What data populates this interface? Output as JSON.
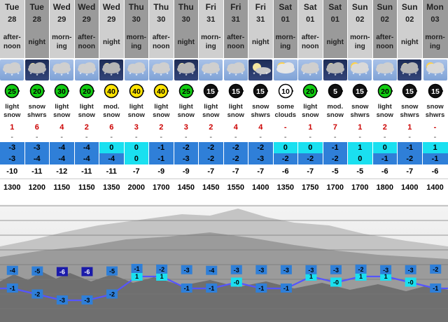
{
  "columns": [
    {
      "day": "Tue",
      "date": "28",
      "time": "after-noon",
      "period": "day",
      "icon": "snow-cloud-icon",
      "wind": "25",
      "wind_style": "green",
      "summary": "light snow",
      "snow": "1",
      "rain": "-",
      "max": "-3",
      "min": "-3",
      "max_band": "blue",
      "min_band": "blue",
      "chill": "-10",
      "freezing": "1300"
    },
    {
      "day": "Tue",
      "date": "28",
      "time": "night",
      "period": "night",
      "icon": "night-snow-icon",
      "wind": "20",
      "wind_style": "green",
      "summary": "snow shwrs",
      "snow": "6",
      "rain": "-",
      "max": "-3",
      "min": "-4",
      "max_band": "blue",
      "min_band": "blue",
      "chill": "-11",
      "freezing": "1200"
    },
    {
      "day": "Wed",
      "date": "29",
      "time": "morn-ing",
      "period": "day",
      "icon": "snow-cloud-icon",
      "wind": "30",
      "wind_style": "green",
      "summary": "light snow",
      "snow": "4",
      "rain": "-",
      "max": "-4",
      "min": "-4",
      "max_band": "blue",
      "min_band": "blue",
      "chill": "-12",
      "freezing": "1150"
    },
    {
      "day": "Wed",
      "date": "29",
      "time": "after-noon",
      "period": "day",
      "icon": "snow-cloud-icon",
      "wind": "20",
      "wind_style": "green",
      "summary": "light snow",
      "snow": "2",
      "rain": "-",
      "max": "-4",
      "min": "-4",
      "max_band": "blue",
      "min_band": "blue",
      "chill": "-11",
      "freezing": "1150"
    },
    {
      "day": "Wed",
      "date": "29",
      "time": "night",
      "period": "night",
      "icon": "night-snow-icon",
      "wind": "40",
      "wind_style": "yellow",
      "summary": "mod. snow",
      "snow": "6",
      "rain": "-",
      "max": "0",
      "min": "-4",
      "max_band": "cyan",
      "min_band": "blue",
      "chill": "-11",
      "freezing": "1350"
    },
    {
      "day": "Thu",
      "date": "30",
      "time": "morn-ing",
      "period": "day",
      "icon": "snow-cloud-icon",
      "wind": "40",
      "wind_style": "yellow",
      "summary": "light snow",
      "snow": "3",
      "rain": "-",
      "max": "0",
      "min": "0",
      "max_band": "cyan",
      "min_band": "cyan",
      "chill": "-7",
      "freezing": "2000"
    },
    {
      "day": "Thu",
      "date": "30",
      "time": "after-noon",
      "period": "day",
      "icon": "snow-cloud-icon",
      "wind": "40",
      "wind_style": "yellow",
      "summary": "light snow",
      "snow": "2",
      "rain": "-",
      "max": "-1",
      "min": "-1",
      "max_band": "blue",
      "min_band": "blue",
      "chill": "-9",
      "freezing": "1700"
    },
    {
      "day": "Thu",
      "date": "30",
      "time": "night",
      "period": "night",
      "icon": "night-snow-icon",
      "wind": "25",
      "wind_style": "green",
      "summary": "light snow",
      "snow": "3",
      "rain": "-",
      "max": "-2",
      "min": "-3",
      "max_band": "blue",
      "min_band": "blue",
      "chill": "-9",
      "freezing": "1450"
    },
    {
      "day": "Fri",
      "date": "31",
      "time": "morn-ing",
      "period": "day",
      "icon": "snow-cloud-icon",
      "wind": "15",
      "wind_style": "black",
      "summary": "light snow",
      "snow": "2",
      "rain": "-",
      "max": "-2",
      "min": "-2",
      "max_band": "blue",
      "min_band": "blue",
      "chill": "-7",
      "freezing": "1450"
    },
    {
      "day": "Fri",
      "date": "31",
      "time": "after-noon",
      "period": "day",
      "icon": "snow-cloud-icon",
      "wind": "15",
      "wind_style": "black",
      "summary": "light snow",
      "snow": "4",
      "rain": "-",
      "max": "-2",
      "min": "-2",
      "max_band": "blue",
      "min_band": "blue",
      "chill": "-7",
      "freezing": "1550"
    },
    {
      "day": "Fri",
      "date": "31",
      "time": "night",
      "period": "night",
      "icon": "night-moon-cloud-icon",
      "wind": "15",
      "wind_style": "black",
      "summary": "snow shwrs",
      "snow": "4",
      "rain": "-",
      "max": "-2",
      "min": "-3",
      "max_band": "blue",
      "min_band": "blue",
      "chill": "-7",
      "freezing": "1400"
    },
    {
      "day": "Sat",
      "date": "01",
      "time": "morn-ing",
      "period": "day",
      "icon": "sun-cloud-icon",
      "wind": "10",
      "wind_style": "white",
      "summary": "some clouds",
      "snow": "-",
      "rain": "-",
      "max": "0",
      "min": "-2",
      "max_band": "cyan",
      "min_band": "blue",
      "chill": "-6",
      "freezing": "1350"
    },
    {
      "day": "Sat",
      "date": "01",
      "time": "after-noon",
      "period": "day",
      "icon": "snow-cloud-icon",
      "wind": "20",
      "wind_style": "green",
      "summary": "light snow",
      "snow": "1",
      "rain": "-",
      "max": "0",
      "min": "-2",
      "max_band": "cyan",
      "min_band": "blue",
      "chill": "-7",
      "freezing": "1750"
    },
    {
      "day": "Sat",
      "date": "01",
      "time": "night",
      "period": "night",
      "icon": "night-snow-icon",
      "wind": "5",
      "wind_style": "black",
      "summary": "mod. snow",
      "snow": "7",
      "rain": "-",
      "max": "-1",
      "min": "-2",
      "max_band": "blue",
      "min_band": "blue",
      "chill": "-5",
      "freezing": "1700"
    },
    {
      "day": "Sun",
      "date": "02",
      "time": "morn-ing",
      "period": "day",
      "icon": "sun-snow-icon",
      "wind": "15",
      "wind_style": "black",
      "summary": "snow shwrs",
      "snow": "1",
      "rain": "-",
      "max": "1",
      "min": "0",
      "max_band": "cyan",
      "min_band": "cyan",
      "chill": "-5",
      "freezing": "1700"
    },
    {
      "day": "Sun",
      "date": "02",
      "time": "after-noon",
      "period": "day",
      "icon": "snow-cloud-icon",
      "wind": "20",
      "wind_style": "green",
      "summary": "light snow",
      "snow": "2",
      "rain": "-",
      "max": "0",
      "min": "-1",
      "max_band": "cyan",
      "min_band": "blue",
      "chill": "-6",
      "freezing": "1800"
    },
    {
      "day": "Sun",
      "date": "02",
      "time": "night",
      "period": "night",
      "icon": "night-snow-icon",
      "wind": "15",
      "wind_style": "black",
      "summary": "snow shwrs",
      "snow": "1",
      "rain": "-",
      "max": "-1",
      "min": "-2",
      "max_band": "blue",
      "min_band": "blue",
      "chill": "-7",
      "freezing": "1400"
    },
    {
      "day": "Mon",
      "date": "03",
      "time": "morn-ing",
      "period": "day",
      "icon": "sun-snow-icon",
      "wind": "15",
      "wind_style": "black",
      "summary": "snow shwrs",
      "snow": "-",
      "rain": "-",
      "max": "1",
      "min": "-1",
      "max_band": "cyan",
      "min_band": "blue",
      "chill": "-6",
      "freezing": "1400"
    }
  ],
  "chart_data": {
    "type": "line",
    "x": [
      "Tue 28 after-noon",
      "Tue 28 night",
      "Wed 29 morn-ing",
      "Wed 29 after-noon",
      "Wed 29 night",
      "Thu 30 morn-ing",
      "Thu 30 after-noon",
      "Thu 30 night",
      "Fri 31 morn-ing",
      "Fri 31 after-noon",
      "Fri 31 night",
      "Sat 01 morn-ing",
      "Sat 01 after-noon",
      "Sat 01 night",
      "Sun 02 morn-ing",
      "Sun 02 after-noon",
      "Sun 02 night",
      "Mon 03 morn-ing"
    ],
    "series": [
      {
        "values": [
          -1,
          -2,
          -3,
          -3,
          -2,
          1,
          1,
          -1,
          -1,
          0,
          -1,
          -1,
          1,
          0,
          1,
          1,
          0,
          -1
        ],
        "labels": [
          "-1",
          "-2",
          "-3",
          "-3",
          "-2",
          "1",
          "1",
          "-1",
          "-1",
          "-0",
          "-1",
          "-1",
          "1",
          "-0",
          "1",
          "1",
          "-0",
          "-1"
        ],
        "color": "#5555ff"
      },
      {
        "values": [
          -4,
          -5,
          -6,
          -6,
          -5,
          -1,
          -2,
          -3,
          -4,
          -3,
          -3,
          -3,
          -3,
          -3,
          -2,
          -3,
          -3,
          -2
        ],
        "labels": [
          "-4",
          "-5",
          "-6",
          "-6",
          "-5",
          "-1",
          "-2",
          "-3",
          "-4",
          "-3",
          "-3",
          "-3",
          "-3",
          "-3",
          "-2",
          "-3",
          "-3",
          "-2"
        ]
      }
    ]
  },
  "colors": {
    "blue_band": "#2f7fd8",
    "cyan_band": "#1ae0f0",
    "snow_red": "#cc0000",
    "header_light": "#cfcfcf",
    "header_dark": "#9a9a9a",
    "line": "#5555ff"
  }
}
